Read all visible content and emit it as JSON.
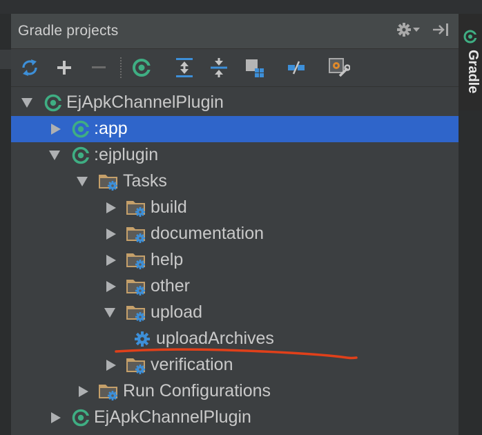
{
  "panel": {
    "title": "Gradle projects",
    "title_icons": [
      "gear-icon",
      "chevron-down-icon",
      "hide-panel-icon"
    ]
  },
  "toolbar": {
    "buttons": [
      {
        "name": "refresh-all-icon"
      },
      {
        "name": "add-icon"
      },
      {
        "name": "remove-icon"
      },
      {
        "name": "execute-task-icon"
      },
      {
        "name": "expand-all-icon"
      },
      {
        "name": "collapse-all-icon"
      },
      {
        "name": "group-modules-icon"
      },
      {
        "name": "toggle-offline-icon"
      },
      {
        "name": "gradle-settings-icon"
      }
    ]
  },
  "tree": {
    "rows": [
      {
        "label": "EjApkChannelPlugin",
        "depth": 0,
        "expanded": true,
        "icon": "gradle-icon"
      },
      {
        "label": ":app",
        "depth": 1,
        "expanded": false,
        "icon": "gradle-icon",
        "selected": true
      },
      {
        "label": ":ejplugin",
        "depth": 1,
        "expanded": true,
        "icon": "gradle-icon"
      },
      {
        "label": "Tasks",
        "depth": 2,
        "expanded": true,
        "icon": "task-folder-icon"
      },
      {
        "label": "build",
        "depth": 3,
        "expanded": false,
        "icon": "task-folder-icon"
      },
      {
        "label": "documentation",
        "depth": 3,
        "expanded": false,
        "icon": "task-folder-icon"
      },
      {
        "label": "help",
        "depth": 3,
        "expanded": false,
        "icon": "task-folder-icon"
      },
      {
        "label": "other",
        "depth": 3,
        "expanded": false,
        "icon": "task-folder-icon"
      },
      {
        "label": "upload",
        "depth": 3,
        "expanded": true,
        "icon": "task-folder-icon"
      },
      {
        "label": "uploadArchives",
        "depth": 4,
        "leaf": true,
        "icon": "gear-task-icon"
      },
      {
        "label": "verification",
        "depth": 3,
        "expanded": false,
        "icon": "task-folder-icon"
      },
      {
        "label": "Run Configurations",
        "depth": 2,
        "expanded": false,
        "icon": "task-folder-icon"
      },
      {
        "label": "EjApkChannelPlugin",
        "depth": 1,
        "expanded": false,
        "icon": "gradle-icon"
      }
    ]
  },
  "side_tab": {
    "label": "Gradle"
  },
  "colors": {
    "selection": "#2f65ca",
    "gradle_green": "#3fae83",
    "annotation_red": "#e0401a"
  }
}
